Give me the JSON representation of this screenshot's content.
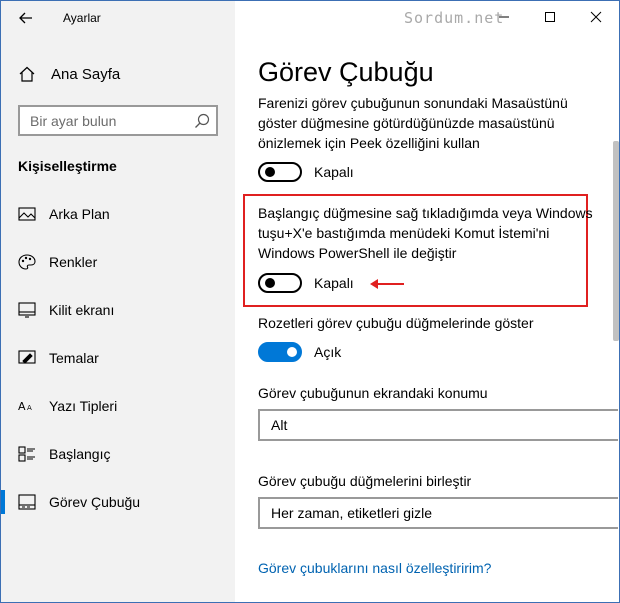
{
  "app": {
    "title": "Ayarlar",
    "watermark": "Sordum.net"
  },
  "sidebar": {
    "home_label": "Ana Sayfa",
    "search_placeholder": "Bir ayar bulun",
    "section_title": "Kişiselleştirme",
    "items": [
      {
        "label": "Arka Plan",
        "icon": "picture-icon"
      },
      {
        "label": "Renkler",
        "icon": "palette-icon"
      },
      {
        "label": "Kilit ekranı",
        "icon": "lock-screen-icon"
      },
      {
        "label": "Temalar",
        "icon": "brush-icon"
      },
      {
        "label": "Yazı Tipleri",
        "icon": "font-icon"
      },
      {
        "label": "Başlangıç",
        "icon": "start-icon"
      },
      {
        "label": "Görev Çubuğu",
        "icon": "taskbar-icon",
        "active": true
      }
    ]
  },
  "main": {
    "title": "Görev Çubuğu",
    "peek": {
      "description": "Farenizi görev çubuğunun sonundaki Masaüstünü göster düğmesine götürdüğünüzde masaüstünü önizlemek için Peek özelliğini kullan",
      "state_label": "Kapalı",
      "on": false
    },
    "powershell": {
      "description": "Başlangıç düğmesine sağ tıkladığımda veya Windows tuşu+X'e bastığımda menüdeki Komut İstemi'ni Windows PowerShell ile değiştir",
      "state_label": "Kapalı",
      "on": false
    },
    "badges": {
      "description": "Rozetleri görev çubuğu düğmelerinde göster",
      "state_label": "Açık",
      "on": true
    },
    "location": {
      "label": "Görev çubuğunun ekrandaki konumu",
      "value": "Alt"
    },
    "combine": {
      "label": "Görev çubuğu düğmelerini birleştir",
      "value": "Her zaman, etiketleri gizle"
    },
    "help_link": "Görev çubuklarını nasıl özelleştiririm?"
  },
  "colors": {
    "accent": "#0078d7",
    "highlight": "#e02020",
    "link": "#0063b1",
    "sidebar_bg": "#f2f2f2"
  }
}
